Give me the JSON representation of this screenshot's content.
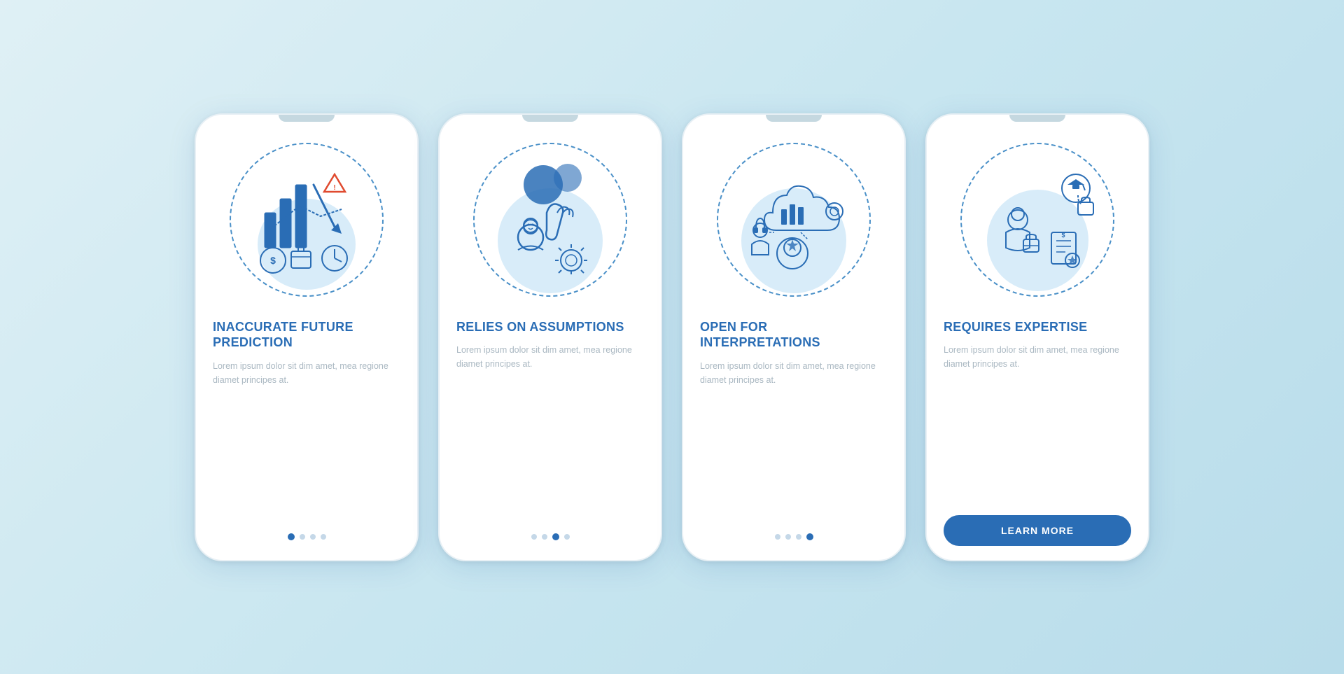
{
  "background": {
    "color": "#c8e6f0"
  },
  "cards": [
    {
      "id": "card-1",
      "title": "INACCURATE FUTURE PREDICTION",
      "body": "Lorem ipsum dolor sit dim amet, mea regione diamet principes at.",
      "dots": [
        {
          "active": true
        },
        {
          "active": false
        },
        {
          "active": false
        },
        {
          "active": false
        }
      ],
      "has_button": false,
      "button_label": null
    },
    {
      "id": "card-2",
      "title": "RELIES ON ASSUMPTIONS",
      "body": "Lorem ipsum dolor sit dim amet, mea regione diamet principes at.",
      "dots": [
        {
          "active": false
        },
        {
          "active": false
        },
        {
          "active": true
        },
        {
          "active": false
        }
      ],
      "has_button": false,
      "button_label": null
    },
    {
      "id": "card-3",
      "title": "OPEN FOR INTERPRETATIONS",
      "body": "Lorem ipsum dolor sit dim amet, mea regione diamet principes at.",
      "dots": [
        {
          "active": false
        },
        {
          "active": false
        },
        {
          "active": false
        },
        {
          "active": true
        }
      ],
      "has_button": false,
      "button_label": null
    },
    {
      "id": "card-4",
      "title": "REQUIRES EXPERTISE",
      "body": "Lorem ipsum dolor sit dim amet, mea regione diamet principes at.",
      "dots": [],
      "has_button": true,
      "button_label": "LEARN MORE"
    }
  ]
}
